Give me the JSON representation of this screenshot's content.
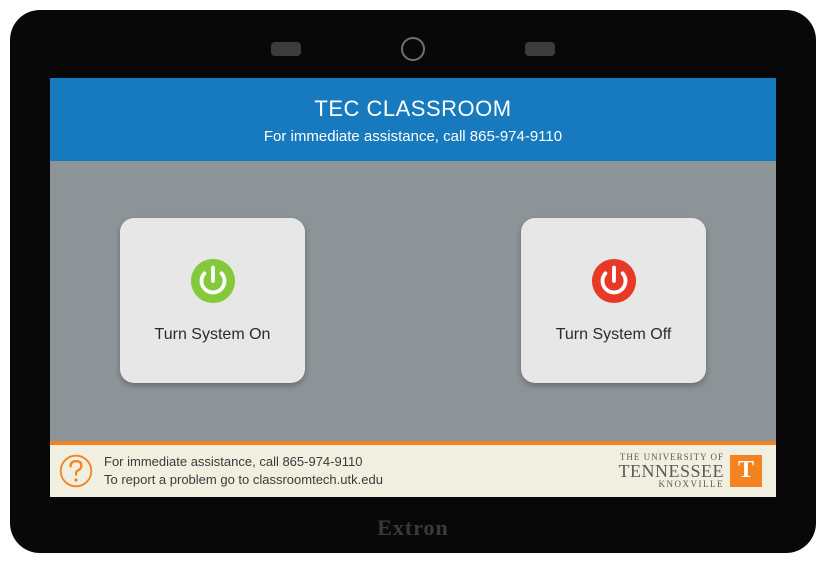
{
  "header": {
    "title": "TEC CLASSROOM",
    "subtitle": "For immediate assistance, call 865-974-9110"
  },
  "buttons": {
    "on_label": "Turn System On",
    "off_label": "Turn System Off"
  },
  "footer": {
    "line1": "For immediate assistance, call 865-974-9110",
    "line2": "To report a problem go to classroomtech.utk.edu"
  },
  "logo": {
    "line1": "THE UNIVERSITY OF",
    "line2": "TENNESSEE",
    "line3": "KNOXVILLE",
    "letter": "T"
  },
  "device": {
    "brand": "Extron"
  },
  "colors": {
    "header_bg": "#177abf",
    "power_on": "#84c83c",
    "power_off": "#e63a27",
    "accent_orange": "#f58220"
  }
}
